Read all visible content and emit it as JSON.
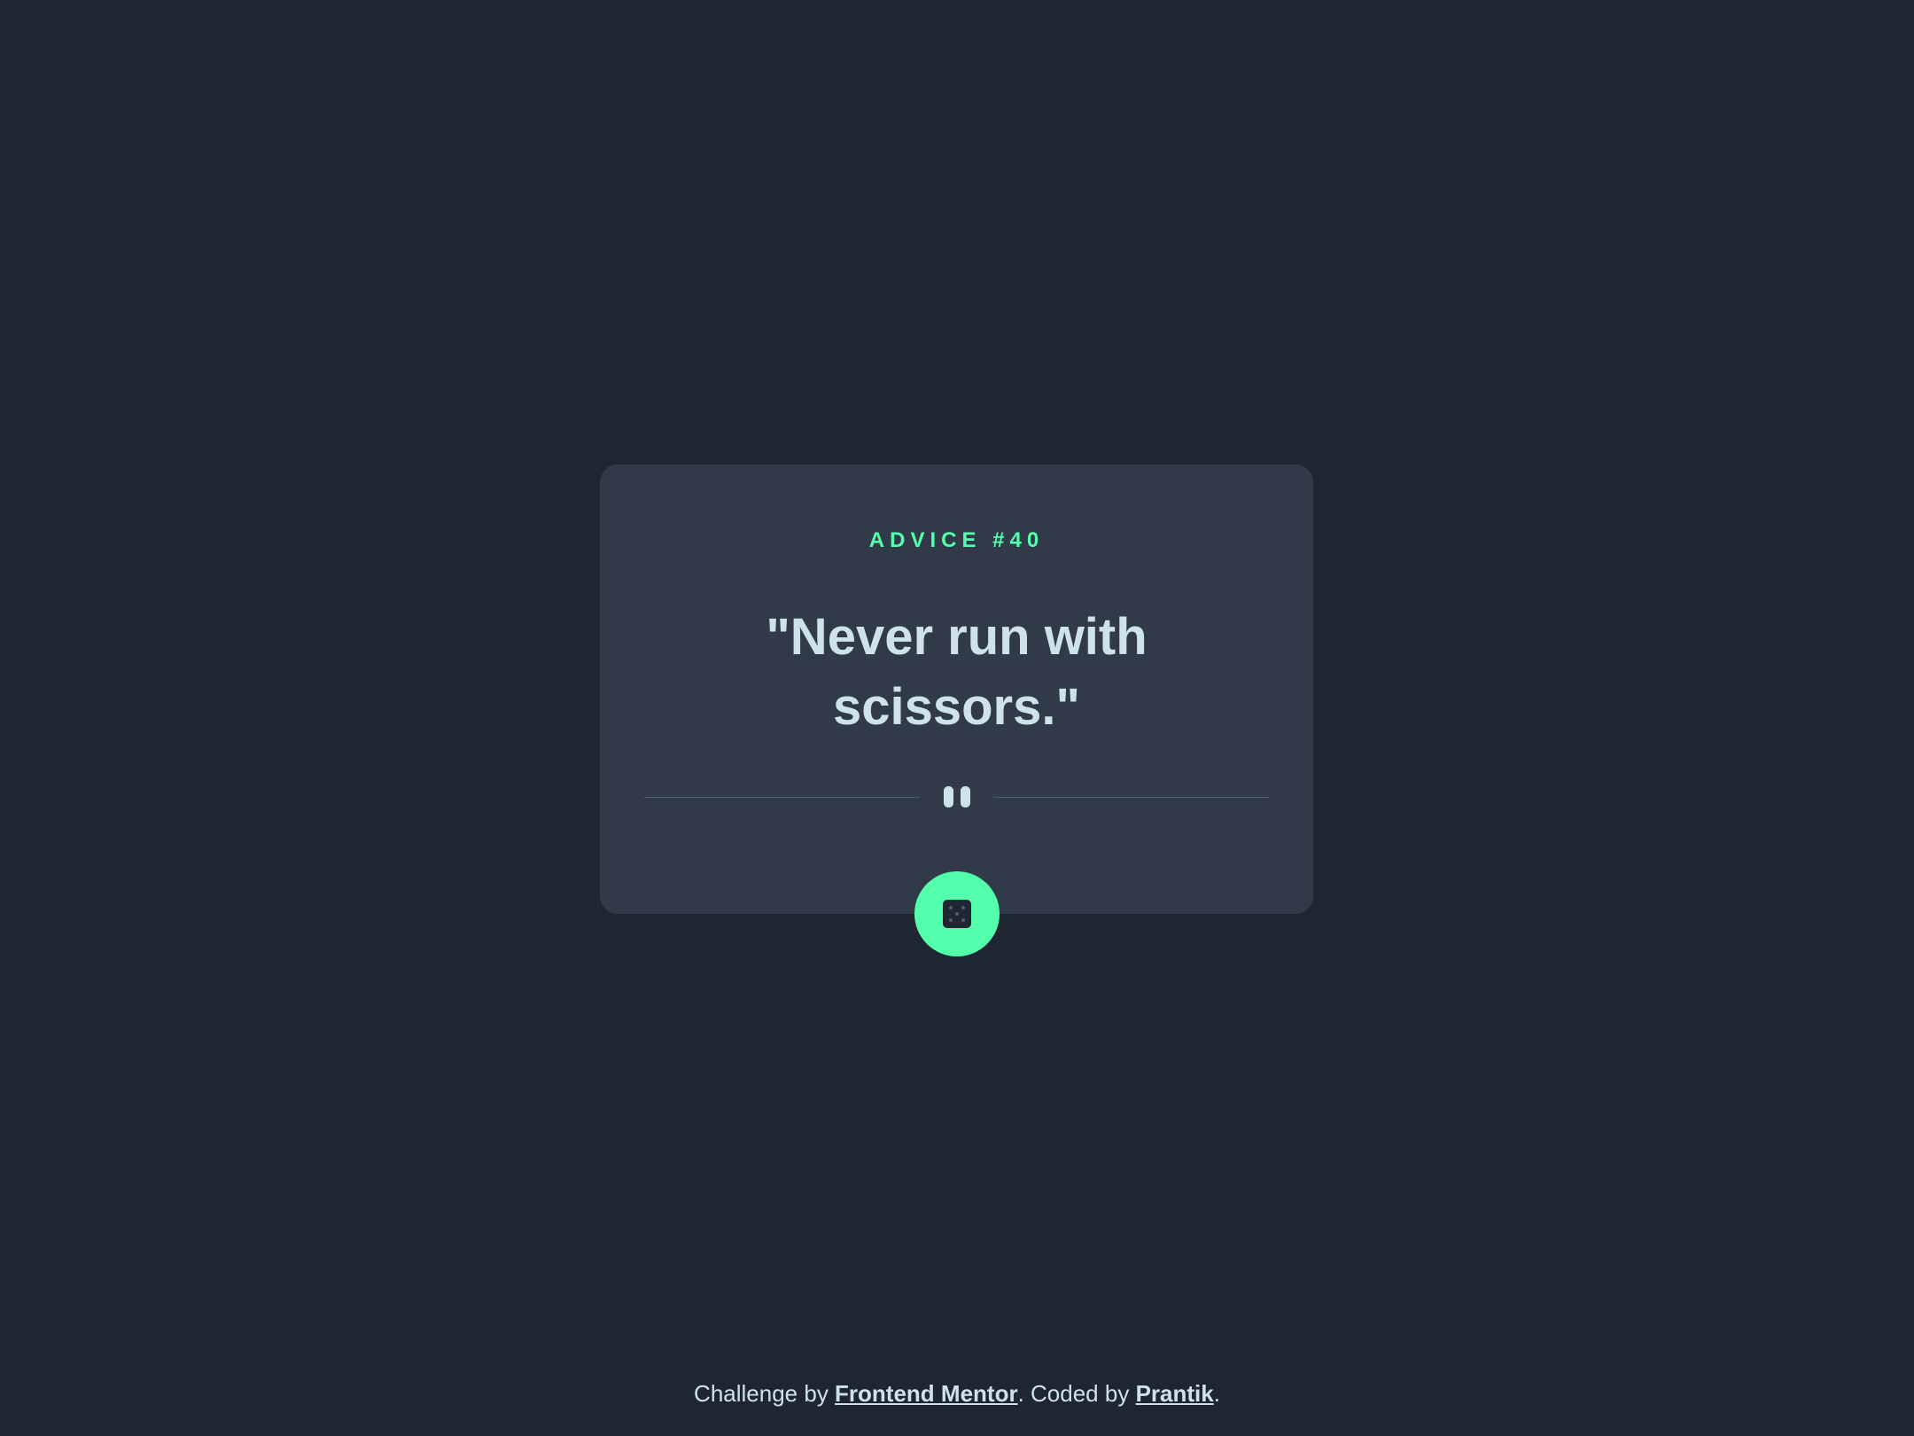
{
  "card": {
    "advice_label": "ADVICE #40",
    "advice_text": "\"Never run with scissors.\""
  },
  "divider": {
    "icon": "pause-icon"
  },
  "dice_button": {
    "icon": "dice-icon"
  },
  "attribution": {
    "prefix": "Challenge by ",
    "challenge_link": "Frontend Mentor",
    "middle": ". Coded by ",
    "author_link": "Prantik",
    "suffix": "."
  },
  "colors": {
    "background": "#1f2632",
    "card": "#313a48",
    "accent": "#53ffaa",
    "text": "#cee3e9",
    "divider": "#4f5d74"
  }
}
